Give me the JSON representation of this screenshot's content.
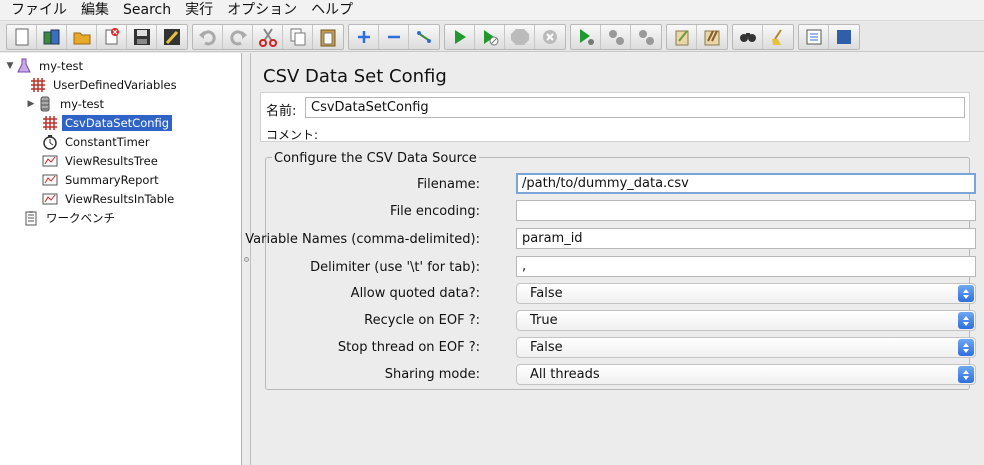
{
  "menu": [
    "ファイル",
    "編集",
    "Search",
    "実行",
    "オプション",
    "ヘルプ"
  ],
  "toolbar": {
    "groups": [
      [
        "new-icon",
        "templates-icon",
        "open-icon",
        "close-icon",
        "save-icon",
        "save-as-icon"
      ],
      [
        "undo-icon",
        "redo-icon",
        "cut-icon",
        "copy-icon",
        "paste-icon"
      ],
      [
        "expand-icon",
        "collapse-icon",
        "toggle-icon"
      ],
      [
        "start-icon",
        "start-no-pauses-icon",
        "stop-icon",
        "shutdown-icon"
      ],
      [
        "remote-start-icon",
        "remote-stop-icon",
        "remote-shutdown-icon"
      ],
      [
        "clear-icon",
        "clear-all-icon"
      ],
      [
        "search-icon",
        "reset-search-icon"
      ],
      [
        "function-helper-icon",
        "help-icon"
      ]
    ]
  },
  "tree": {
    "items": [
      {
        "label": "my-test",
        "icon": "test-plan-icon",
        "level": 0,
        "arrow": "▼",
        "selected": false
      },
      {
        "label": "UserDefinedVariables",
        "icon": "config-icon",
        "level": 1,
        "arrow": "",
        "selected": false
      },
      {
        "label": "my-test",
        "icon": "thread-group-icon",
        "level": 1,
        "arrow": "▶",
        "selected": false
      },
      {
        "label": "CsvDataSetConfig",
        "icon": "config-icon",
        "level": 1,
        "arrow": "",
        "selected": true
      },
      {
        "label": "ConstantTimer",
        "icon": "timer-icon",
        "level": 1,
        "arrow": "",
        "selected": false
      },
      {
        "label": "ViewResultsTree",
        "icon": "listener-icon",
        "level": 1,
        "arrow": "",
        "selected": false
      },
      {
        "label": "SummaryReport",
        "icon": "listener-icon",
        "level": 1,
        "arrow": "",
        "selected": false
      },
      {
        "label": "ViewResultsInTable",
        "icon": "listener-icon",
        "level": 1,
        "arrow": "",
        "selected": false
      },
      {
        "label": "ワークベンチ",
        "icon": "workbench-icon",
        "level": 0,
        "arrow": "",
        "selected": false
      }
    ]
  },
  "panel": {
    "title": "CSV Data Set Config",
    "name_label": "名前:",
    "name_value": "CsvDataSetConfig",
    "comment_label": "コメント:",
    "section_title": "Configure the CSV Data Source",
    "fields": [
      {
        "label": "Filename:",
        "value": "/path/to/dummy_data.csv",
        "type": "text"
      },
      {
        "label": "File encoding:",
        "value": "",
        "type": "text"
      },
      {
        "label": "Variable Names (comma-delimited):",
        "value": "param_id",
        "type": "text"
      },
      {
        "label": "Delimiter (use '\\t' for tab):",
        "value": ",",
        "type": "text"
      },
      {
        "label": "Allow quoted data?:",
        "value": "False",
        "type": "select"
      },
      {
        "label": "Recycle on EOF ?:",
        "value": "True",
        "type": "select"
      },
      {
        "label": "Stop thread on EOF ?:",
        "value": "False",
        "type": "select"
      },
      {
        "label": "Sharing mode:",
        "value": "All threads",
        "type": "select"
      }
    ]
  },
  "colors": {
    "selection": "#2f63c5",
    "focus_border": "#7ba5d8",
    "select_arrow": "#2f6fdc"
  }
}
